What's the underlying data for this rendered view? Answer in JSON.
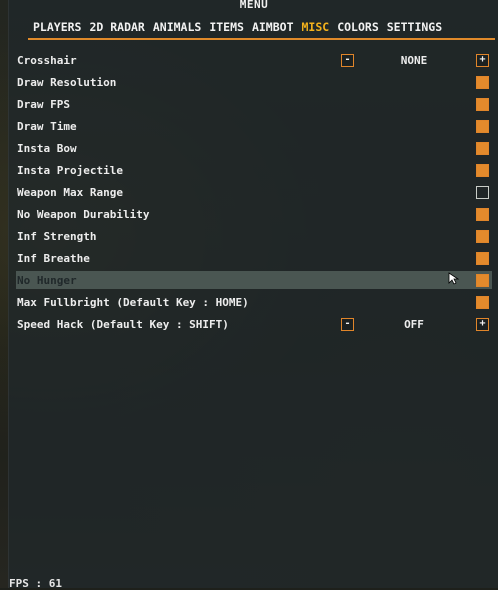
{
  "menu": {
    "title": "MENU"
  },
  "tabs": [
    "PLAYERS",
    "2D RADAR",
    "ANIMALS",
    "ITEMS",
    "AIMBOT",
    "MISC",
    "COLORS",
    "SETTINGS"
  ],
  "active_tab": "MISC",
  "accent_color": "#e38a2c",
  "active_tab_color": "#f4b21c",
  "crosshair": {
    "label": "Crosshair",
    "value": "NONE",
    "minus": "-",
    "plus": "+"
  },
  "options": [
    {
      "label": "Draw Resolution",
      "checked": true
    },
    {
      "label": "Draw FPS",
      "checked": true
    },
    {
      "label": "Draw Time",
      "checked": true
    },
    {
      "label": "Insta Bow",
      "checked": true
    },
    {
      "label": "Insta Projectile",
      "checked": true
    },
    {
      "label": "Weapon Max Range",
      "checked": false
    },
    {
      "label": "No Weapon Durability",
      "checked": true
    },
    {
      "label": "Inf Strength",
      "checked": true
    },
    {
      "label": "Inf Breathe",
      "checked": true
    },
    {
      "label": "No Hunger",
      "checked": true,
      "hovered": true
    },
    {
      "label": "Max Fullbright (Default Key : HOME)",
      "checked": true
    }
  ],
  "speed_hack": {
    "label": "Speed Hack (Default Key : SHIFT)",
    "value": "OFF",
    "minus": "-",
    "plus": "+"
  },
  "fps_overlay": {
    "text": "FPS : 61"
  }
}
